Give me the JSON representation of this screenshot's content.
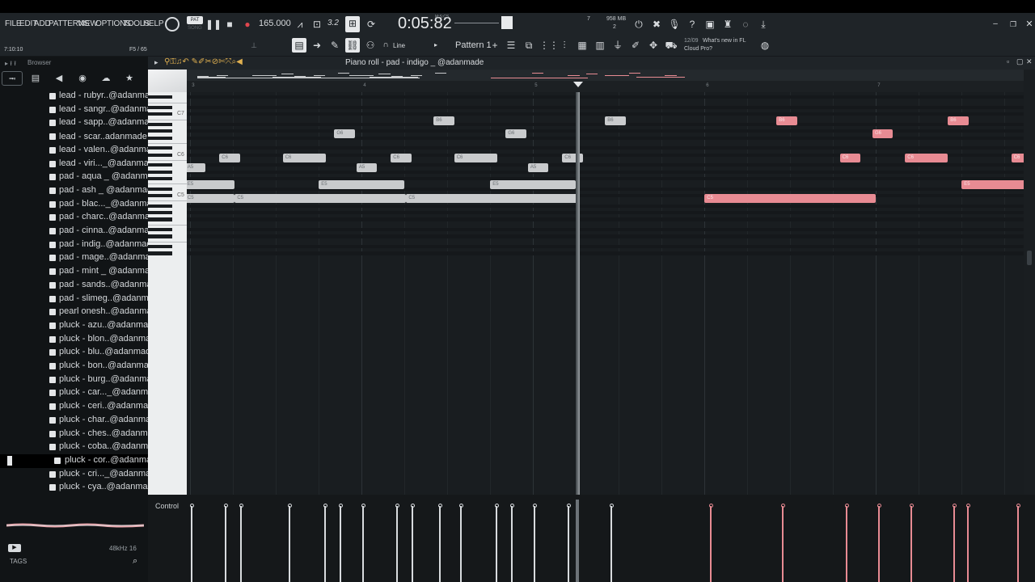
{
  "menu": {
    "file": "FILE",
    "edit": "EDIT",
    "add": "ADD",
    "patterns": "PATTERNS",
    "view": "VIEW",
    "options": "OPTIONS",
    "tools": "TOOLS",
    "help": "HELP"
  },
  "transport": {
    "pat_label": "PAT",
    "song_label": "SONG",
    "tempo": "165.000",
    "time": "0:05:82",
    "time_format": "M:S:CS",
    "memory": "958 MB",
    "cpu": "2",
    "cpu_pct": "7",
    "step": "3.2",
    "snap_label": "Line",
    "pattern": "Pattern 1",
    "news_date": "12/09",
    "news_text_1": "What's new in FL",
    "news_text_2": "Cloud Pro?",
    "hint_left": "7:10:10",
    "hint_right": "F5 / 65"
  },
  "browser": {
    "title": "Browser",
    "items": [
      {
        "label": "lead - rubyr..@adanmade"
      },
      {
        "label": "lead - sangr..@adanmade"
      },
      {
        "label": "lead - sapp..@adanmade"
      },
      {
        "label": "lead - scar..adanmade★"
      },
      {
        "label": "lead - valen..@adanmade"
      },
      {
        "label": "lead - viri..._@adanmade"
      },
      {
        "label": "pad - aqua _ @adanmade"
      },
      {
        "label": "pad - ash _ @adanmade"
      },
      {
        "label": "pad - blac..._@adanmade"
      },
      {
        "label": "pad - charc..@adanmade"
      },
      {
        "label": "pad - cinna..@adanmade"
      },
      {
        "label": "pad - indig..@adanmade"
      },
      {
        "label": "pad - mage..@adanmade"
      },
      {
        "label": "pad - mint _ @adanmade"
      },
      {
        "label": "pad - sands..@adanmade"
      },
      {
        "label": "pad - slimeg..@adanmade"
      },
      {
        "label": "pearl onesh..@adanmade"
      },
      {
        "label": "pluck - azu..@adanmade"
      },
      {
        "label": "pluck - blon..@adanmade"
      },
      {
        "label": "pluck - blu..@adanmade"
      },
      {
        "label": "pluck - bon..@adanmade"
      },
      {
        "label": "pluck - burg..@adanmade"
      },
      {
        "label": "pluck - car..._@adanmade"
      },
      {
        "label": "pluck - ceri..@adanmade"
      },
      {
        "label": "pluck - char..@adanmade"
      },
      {
        "label": "pluck - ches..@adanmade"
      },
      {
        "label": "pluck - coba..@adanmade"
      },
      {
        "label": "pluck - cor..@adanmade"
      },
      {
        "label": "pluck - cri..._@adanmade"
      },
      {
        "label": "pluck - cya..@adanmade"
      }
    ],
    "selected_index": 27,
    "sample_info": "48kHz 16",
    "tags_label": "TAGS"
  },
  "piano_roll": {
    "title": "Piano roll - pad - indigo _ @adanmade",
    "key_labels": {
      "c7": "C7",
      "c6": "C6",
      "c5": "C5"
    },
    "ruler_marks": [
      "3",
      "4",
      "5",
      "6",
      "7"
    ],
    "control_label": "Control",
    "note_colors": {
      "grey": "#c9cbcd",
      "pink": "#e88b93"
    },
    "notes": [
      {
        "pitch": "B6",
        "color": "grey",
        "bar_start": 4.42,
        "bar_len": 0.12
      },
      {
        "pitch": "B6",
        "color": "grey",
        "bar_start": 5.42,
        "bar_len": 0.12
      },
      {
        "pitch": "B6",
        "color": "pink",
        "bar_start": 6.42,
        "bar_len": 0.12
      },
      {
        "pitch": "B6",
        "color": "pink",
        "bar_start": 7.42,
        "bar_len": 0.12
      },
      {
        "pitch": "G6",
        "color": "grey",
        "bar_start": 3.84,
        "bar_len": 0.12
      },
      {
        "pitch": "G6",
        "color": "grey",
        "bar_start": 4.84,
        "bar_len": 0.12
      },
      {
        "pitch": "G6",
        "color": "pink",
        "bar_start": 6.98,
        "bar_len": 0.12
      },
      {
        "pitch": "C6",
        "color": "grey",
        "bar_start": 3.17,
        "bar_len": 0.12
      },
      {
        "pitch": "C6",
        "color": "grey",
        "bar_start": 3.54,
        "bar_len": 0.25
      },
      {
        "pitch": "C6",
        "color": "grey",
        "bar_start": 4.17,
        "bar_len": 0.12
      },
      {
        "pitch": "C6",
        "color": "grey",
        "bar_start": 4.54,
        "bar_len": 0.25
      },
      {
        "pitch": "C6",
        "color": "grey",
        "bar_start": 5.17,
        "bar_len": 0.12
      },
      {
        "pitch": "C6",
        "color": "pink",
        "bar_start": 6.79,
        "bar_len": 0.12
      },
      {
        "pitch": "C6",
        "color": "pink",
        "bar_start": 7.17,
        "bar_len": 0.25
      },
      {
        "pitch": "C6",
        "color": "pink",
        "bar_start": 7.79,
        "bar_len": 0.12
      },
      {
        "pitch": "A5",
        "color": "grey",
        "bar_start": 2.97,
        "bar_len": 0.12
      },
      {
        "pitch": "A5",
        "color": "grey",
        "bar_start": 3.97,
        "bar_len": 0.12
      },
      {
        "pitch": "A5",
        "color": "grey",
        "bar_start": 4.97,
        "bar_len": 0.12
      },
      {
        "pitch": "E5",
        "color": "grey",
        "bar_start": 2.97,
        "bar_len": 0.29
      },
      {
        "pitch": "E5",
        "color": "grey",
        "bar_start": 3.75,
        "bar_len": 0.5
      },
      {
        "pitch": "E5",
        "color": "grey",
        "bar_start": 4.75,
        "bar_len": 0.5
      },
      {
        "pitch": "E5",
        "color": "pink",
        "bar_start": 7.5,
        "bar_len": 0.5
      },
      {
        "pitch": "C5",
        "color": "grey",
        "bar_start": 2.97,
        "bar_len": 0.29
      },
      {
        "pitch": "C5",
        "color": "grey",
        "bar_start": 3.26,
        "bar_len": 1.0
      },
      {
        "pitch": "C5",
        "color": "grey",
        "bar_start": 4.26,
        "bar_len": 1.0
      },
      {
        "pitch": "C5",
        "color": "pink",
        "bar_start": 6.0,
        "bar_len": 1.0
      }
    ],
    "playhead_bar": 5.25
  }
}
